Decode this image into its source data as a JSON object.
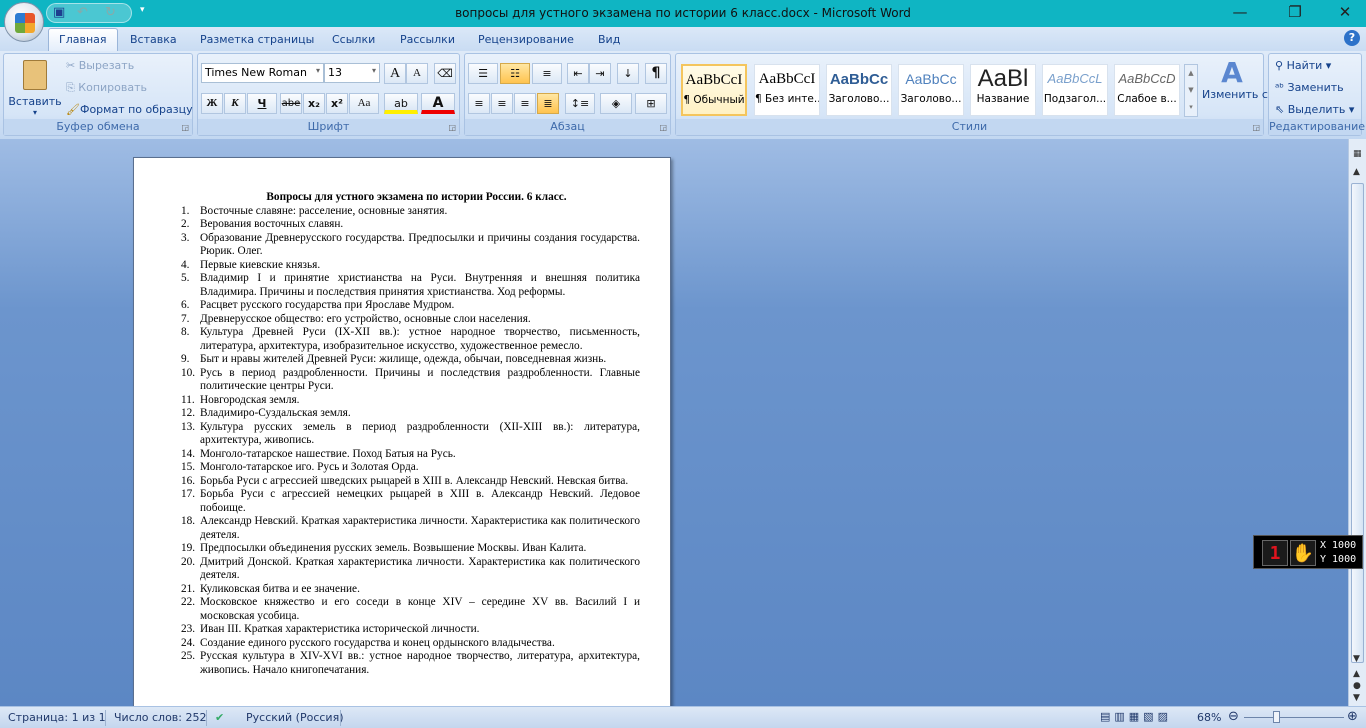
{
  "window": {
    "title": "вопросы для устного экзамена по истории 6 класс.docx - Microsoft Word",
    "minimize": "—",
    "restore": "❐",
    "close": "✕"
  },
  "tabs": [
    "Главная",
    "Вставка",
    "Разметка страницы",
    "Ссылки",
    "Рассылки",
    "Рецензирование",
    "Вид"
  ],
  "clipboard": {
    "paste": "Вставить",
    "cut": "Вырезать",
    "copy": "Копировать",
    "format_painter": "Формат по образцу",
    "label": "Буфер обмена"
  },
  "font": {
    "name": "Times New Roman",
    "size": "13",
    "label": "Шрифт",
    "bold": "Ж",
    "italic": "К",
    "underline": "Ч",
    "strike": "abe",
    "sub": "x₂",
    "sup": "x²",
    "case": "Aa",
    "grow": "A",
    "shrink": "A"
  },
  "paragraph": {
    "label": "Абзац",
    "pilcrow": "¶"
  },
  "styles": {
    "label": "Стили",
    "items": [
      {
        "sample": "AaBbCcI",
        "name": "¶ Обычный"
      },
      {
        "sample": "AaBbCcI",
        "name": "¶ Без инте..."
      },
      {
        "sample": "AaBbCc",
        "name": "Заголово..."
      },
      {
        "sample": "AaBbCc",
        "name": "Заголово..."
      },
      {
        "sample": "AaBl",
        "name": "Название"
      },
      {
        "sample": "AaBbCcL",
        "name": "Подзагол..."
      },
      {
        "sample": "AaBbCcD",
        "name": "Слабое в..."
      }
    ],
    "change": "Изменить стили"
  },
  "editing": {
    "label": "Редактирование",
    "find": "Найти",
    "replace": "Заменить",
    "select": "Выделить"
  },
  "document": {
    "title": "Вопросы для устного экзамена по истории России. 6 класс.",
    "items": [
      "Восточные славяне: расселение, основные занятия.",
      "Верования восточных славян.",
      "Образование Древнерусского государства. Предпосылки и причины создания государства. Рюрик. Олег.",
      "Первые киевские князья.",
      "Владимир I и принятие христианства на Руси. Внутренняя и внешняя политика Владимира. Причины и последствия принятия христианства. Ход реформы.",
      "Расцвет русского государства при Ярославе Мудром.",
      "Древнерусское общество: его устройство, основные слои населения.",
      "Культура Древней Руси (IX-XII вв.): устное народное творчество, письменность, литература, архитектура, изобразительное искусство, художественное ремесло.",
      "Быт и нравы жителей Древней Руси: жилище, одежда, обычаи, повседневная жизнь.",
      "Русь в период раздробленности. Причины и последствия раздробленности. Главные политические центры Руси.",
      "Новгородская земля.",
      "Владимиро-Суздальская земля.",
      "Культура русских земель в период раздробленности (XII-XIII вв.): литература, архитектура, живопись.",
      "Монголо-татарское нашествие. Поход Батыя на Русь.",
      "Монголо-татарское иго. Русь и Золотая Орда.",
      "Борьба Руси с агрессией шведских рыцарей в XIII в. Александр Невский. Невская битва.",
      "Борьба Руси с агрессией немецких рыцарей в XIII в. Александр Невский. Ледовое побоище.",
      "Александр Невский. Краткая характеристика личности. Характеристика как политического деятеля.",
      "Предпосылки объединения русских земель. Возвышение Москвы. Иван Калита.",
      "Дмитрий Донской. Краткая характеристика личности. Характеристика как политического деятеля.",
      "Куликовская битва и ее значение.",
      "Московское княжество и его соседи в конце XIV – середине XV вв. Василий I и московская усобица.",
      "Иван III. Краткая характеристика исторической личности.",
      "Создание единого русского государства и конец ордынского владычества.",
      "Русская культура в XIV-XVI вв.: устное народное творчество, литература, архитектура, живопись. Начало книгопечатания."
    ]
  },
  "status": {
    "page": "Страница: 1 из 1",
    "words": "Число слов: 252",
    "language": "Русский (Россия)",
    "zoom": "68%",
    "zoom_percent": 68
  },
  "overlay": {
    "x": "X 1000",
    "y": "Y 1000"
  }
}
